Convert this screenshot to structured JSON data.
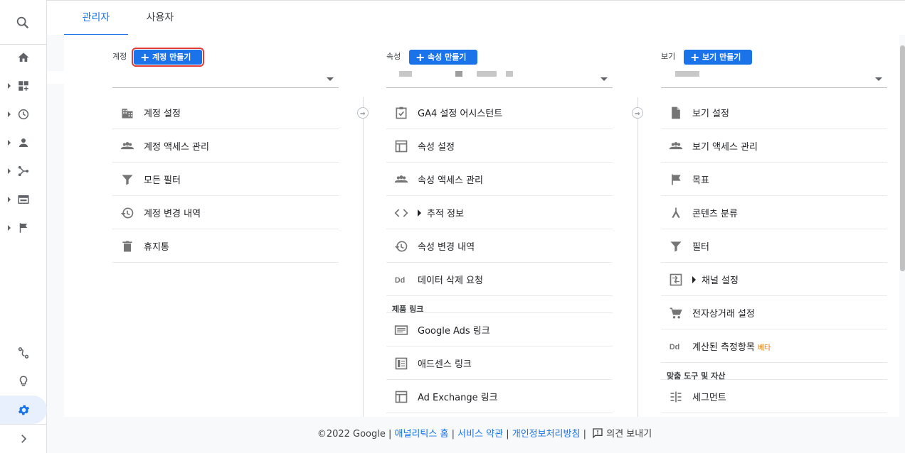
{
  "tabs": [
    {
      "label": "관리자",
      "active": true
    },
    {
      "label": "사용자",
      "active": false
    }
  ],
  "account": {
    "label": "계정",
    "create_label": "계정 만들기",
    "items": [
      {
        "icon": "building-icon",
        "label": "계정 설정"
      },
      {
        "icon": "people-icon",
        "label": "계정 액세스 관리"
      },
      {
        "icon": "filter-icon",
        "label": "모든 필터"
      },
      {
        "icon": "history-icon",
        "label": "계정 변경 내역"
      },
      {
        "icon": "trash-icon",
        "label": "휴지통"
      }
    ]
  },
  "property": {
    "label": "속성",
    "create_label": "속성 만들기",
    "items": [
      {
        "icon": "checklist-icon",
        "label": "GA4 설정 어시스턴트"
      },
      {
        "icon": "layout-icon",
        "label": "속성 설정"
      },
      {
        "icon": "people-icon",
        "label": "속성 액세스 관리"
      },
      {
        "icon": "code-icon",
        "label": "추적 정보"
      },
      {
        "icon": "history-icon",
        "label": "속성 변경 내역"
      },
      {
        "icon": "dd-icon",
        "label": "데이터 삭제 요청"
      }
    ],
    "section_title": "제품 링크",
    "links": [
      {
        "icon": "ads-icon",
        "label": "Google Ads 링크"
      },
      {
        "icon": "adsense-icon",
        "label": "애드센스 링크"
      },
      {
        "icon": "adexchange-icon",
        "label": "Ad Exchange 링크"
      }
    ]
  },
  "view": {
    "label": "보기",
    "create_label": "보기 만들기",
    "items": [
      {
        "icon": "document-icon",
        "label": "보기 설정"
      },
      {
        "icon": "people-icon",
        "label": "보기 액세스 관리"
      },
      {
        "icon": "flag-icon",
        "label": "목표"
      },
      {
        "icon": "grouping-icon",
        "label": "콘텐츠 분류"
      },
      {
        "icon": "filter-icon",
        "label": "필터"
      },
      {
        "icon": "channel-icon",
        "label": "채널 설정"
      },
      {
        "icon": "cart-icon",
        "label": "전자상거래 설정"
      },
      {
        "icon": "dd-icon",
        "label": "계산된 측정항목",
        "badge": "베타"
      }
    ],
    "section_title": "맞춤 도구 및 자산",
    "tools": [
      {
        "icon": "segment-icon",
        "label": "세그먼트"
      }
    ]
  },
  "footer": {
    "copyright": "©2022 Google",
    "sep": "|",
    "links": [
      "애널리틱스 홈",
      "서비스 약관",
      "개인정보처리방침"
    ],
    "feedback": "의견 보내기"
  },
  "colors": {
    "accent": "#1a73e8",
    "highlight": "#e53935",
    "beta": "#e37400"
  }
}
